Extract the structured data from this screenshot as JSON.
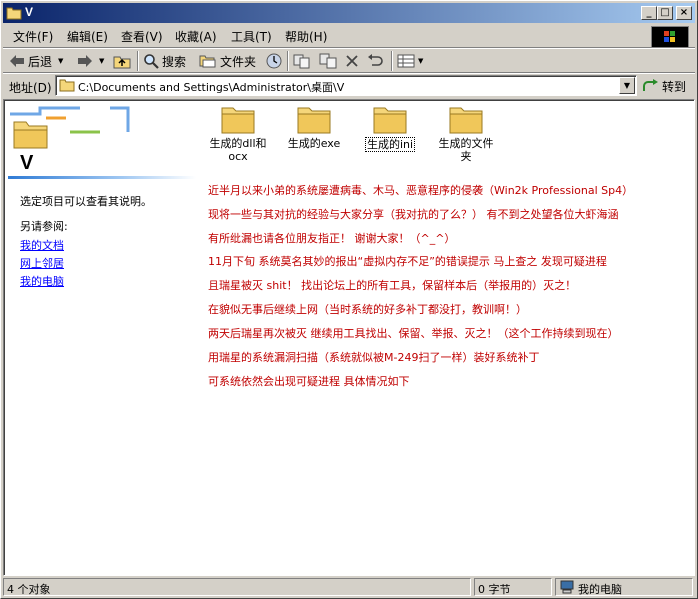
{
  "window": {
    "title": "V"
  },
  "title_buttons": {
    "minimize": "_",
    "maximize": "□",
    "close": "×"
  },
  "menu": [
    {
      "label": "文件(F)"
    },
    {
      "label": "编辑(E)"
    },
    {
      "label": "查看(V)"
    },
    {
      "label": "收藏(A)"
    },
    {
      "label": "工具(T)"
    },
    {
      "label": "帮助(H)"
    }
  ],
  "toolbar": {
    "back_label": "后退",
    "search_label": "搜索",
    "folders_label": "文件夹"
  },
  "address": {
    "label": "地址(D)",
    "value": "C:\\Documents and Settings\\Administrator\\桌面\\V",
    "go_label": "转到"
  },
  "left_pane": {
    "folder_name": "V",
    "description": "选定项目可以查看其说明。",
    "see_also": "另请参阅:",
    "links": [
      "我的文档",
      "网上邻居",
      "我的电脑"
    ]
  },
  "files": [
    {
      "name": "生成的dll和ocx"
    },
    {
      "name": "生成的exe"
    },
    {
      "name": "生成的ini"
    },
    {
      "name": "生成的文件夹"
    }
  ],
  "notes": [
    "近半月以来小弟的系统屡遭病毒、木马、恶意程序的侵袭（Win2k Professional Sp4）",
    "现将一些与其对抗的经验与大家分享（我对抗的了么？） 有不到之处望各位大虾海涵",
    "有所纰漏也请各位朋友指正！ 谢谢大家！（^_^）",
    "11月下旬 系统莫名其妙的报出“虚拟内存不足”的错误提示 马上查之 发现可疑进程",
    "且瑞星被灭 shit！ 找出论坛上的所有工具，保留样本后（举报用的）灭之！",
    "在貌似无事后继续上网（当时系统的好多补丁都没打，教训啊！）",
    "两天后瑞星再次被灭 继续用工具找出、保留、举报、灭之！（这个工作持续到现在）",
    "用瑞星的系统漏洞扫描（系统就似被M-249扫了一样）装好系统补丁",
    "可系统依然会出现可疑进程 具体情况如下"
  ],
  "status": {
    "objects": "4 个对象",
    "size": "0 字节",
    "location": "我的电脑"
  },
  "colors": {
    "title_start": "#0a246a",
    "title_end": "#a6caf0",
    "note_text": "#c00000",
    "link": "#0000ff",
    "folder": "#f5d67a"
  }
}
